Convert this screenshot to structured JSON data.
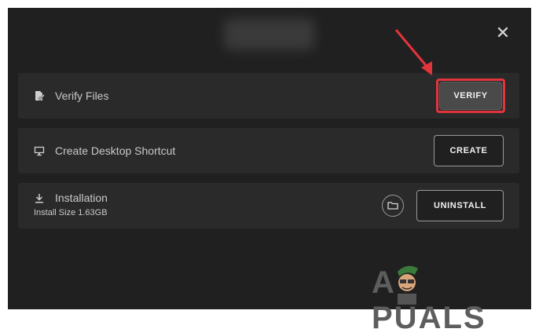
{
  "dialog": {
    "close_glyph": "✕"
  },
  "rows": {
    "verify": {
      "label": "Verify Files",
      "button": "VERIFY",
      "icon": "file-check-icon"
    },
    "shortcut": {
      "label": "Create Desktop Shortcut",
      "button": "CREATE",
      "icon": "monitor-icon"
    },
    "installation": {
      "label": "Installation",
      "sublabel": "Install Size 1.63GB",
      "button": "UNINSTALL",
      "icon": "download-icon"
    }
  },
  "watermark": {
    "text_left": "A",
    "text_right": "PUALS"
  },
  "colors": {
    "highlight": "#e2343b",
    "dialog_bg": "#202020",
    "row_bg": "#2a2a2a"
  }
}
